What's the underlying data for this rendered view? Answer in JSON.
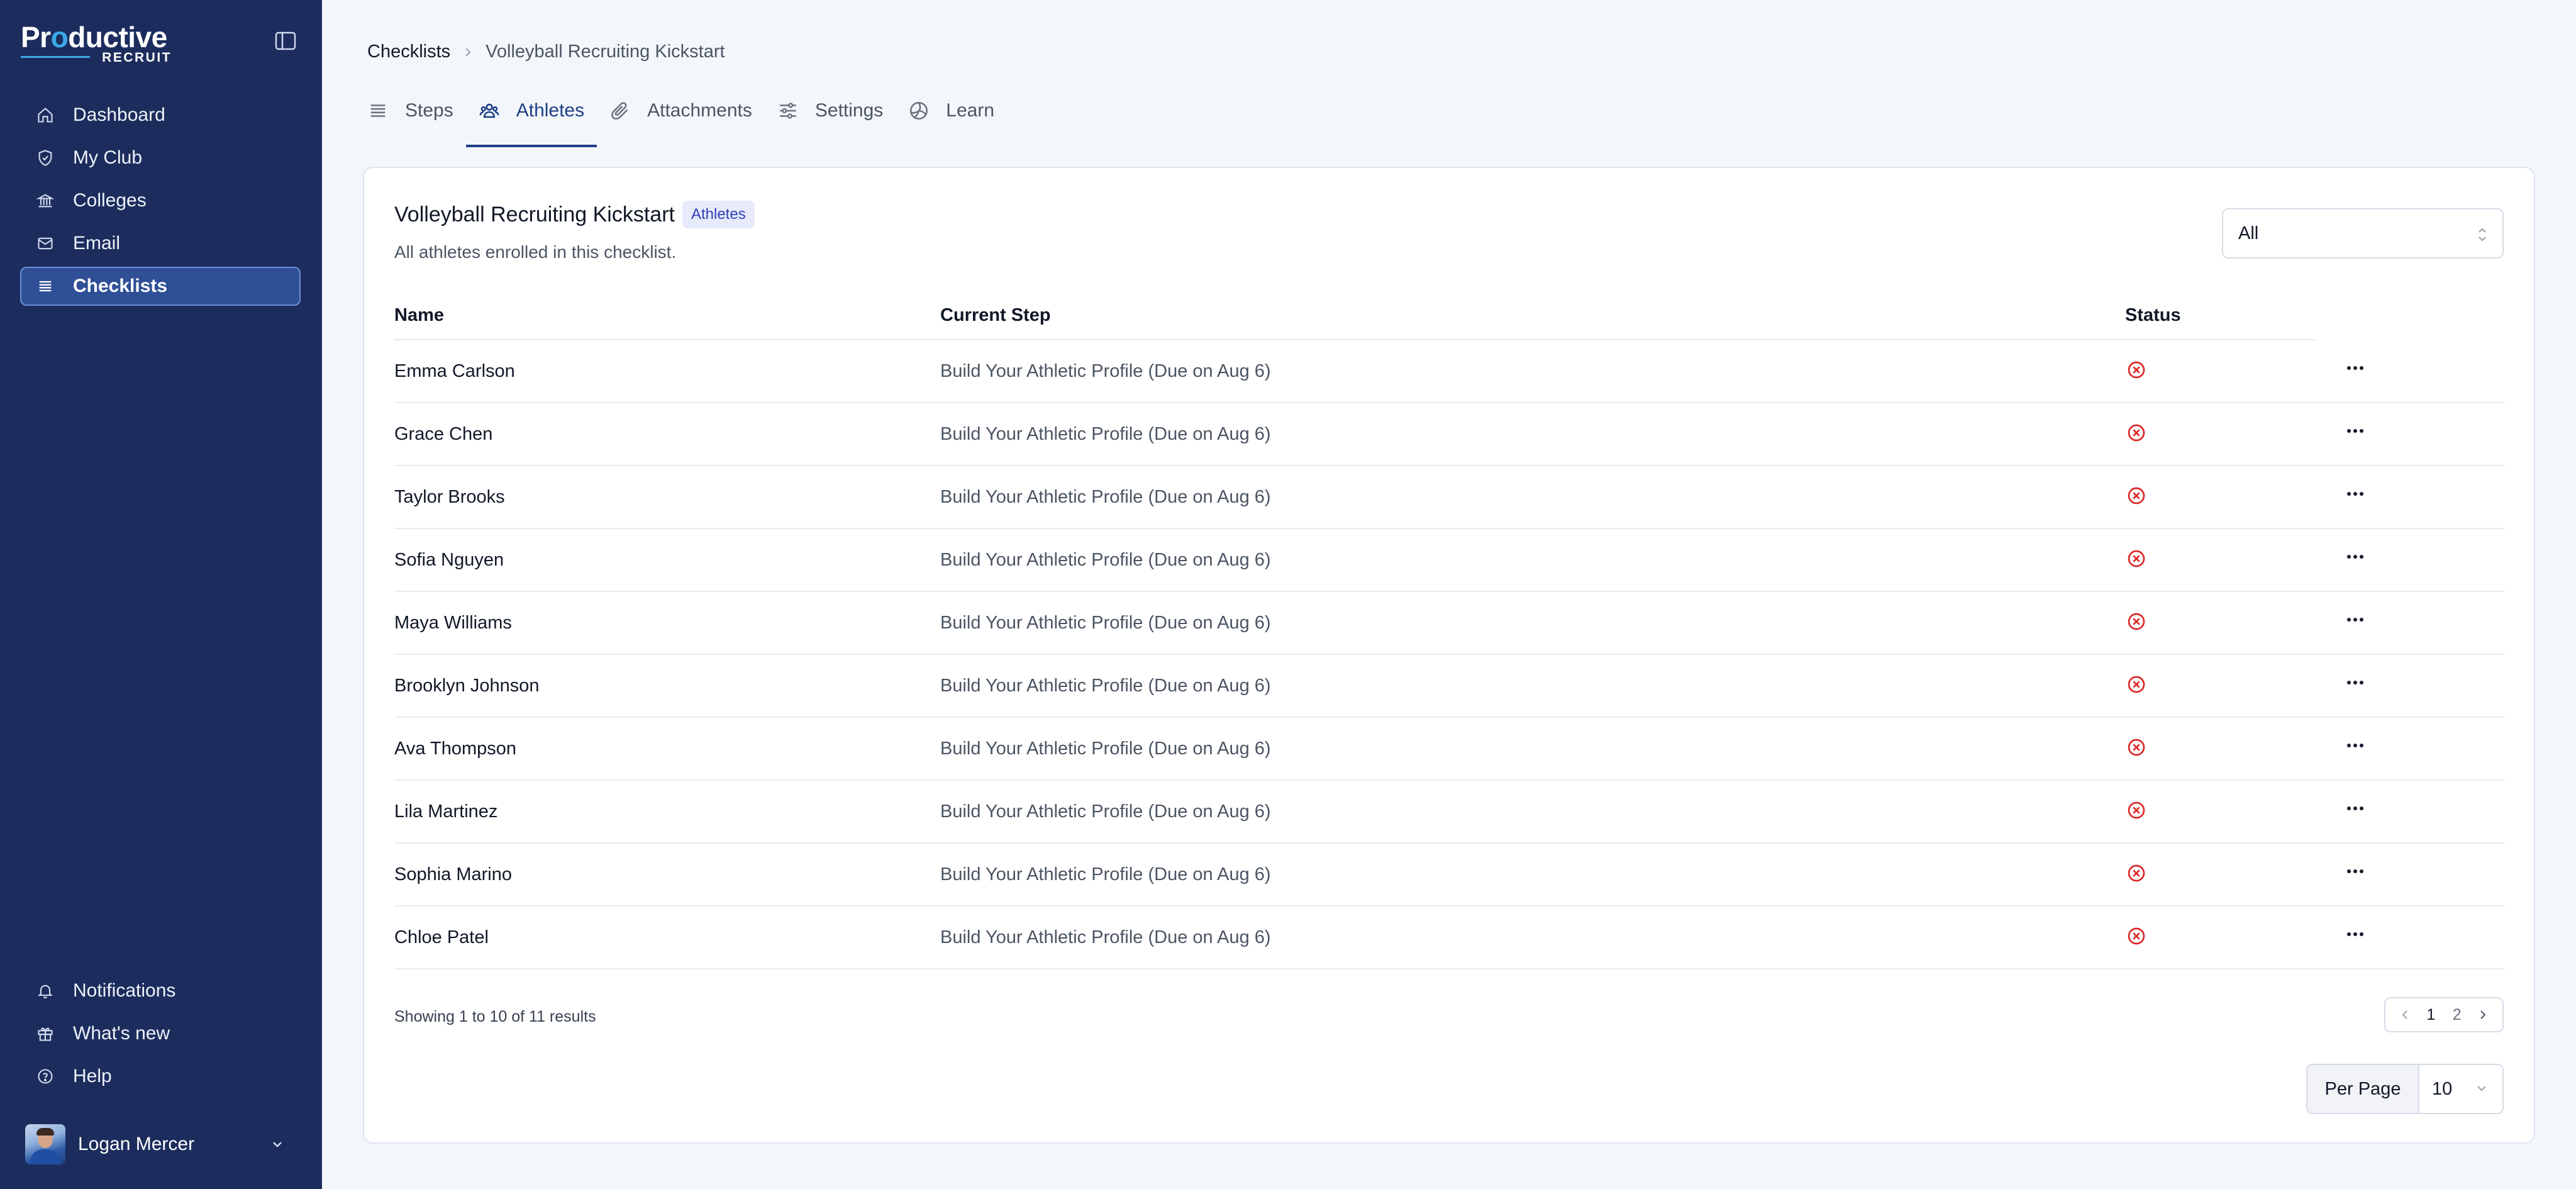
{
  "brand": {
    "name_part1": "Pr",
    "name_o": "o",
    "name_part2": "ductive",
    "subname": "RECRUIT"
  },
  "sidebar": {
    "items": [
      {
        "label": "Dashboard",
        "icon": "home-icon"
      },
      {
        "label": "My Club",
        "icon": "shield-icon"
      },
      {
        "label": "Colleges",
        "icon": "building-icon"
      },
      {
        "label": "Email",
        "icon": "mail-icon"
      },
      {
        "label": "Checklists",
        "icon": "list-icon",
        "active": true
      }
    ],
    "bottom_items": [
      {
        "label": "Notifications",
        "icon": "bell-icon"
      },
      {
        "label": "What's new",
        "icon": "gift-icon"
      },
      {
        "label": "Help",
        "icon": "help-circle-icon"
      }
    ],
    "user": {
      "name": "Logan Mercer"
    }
  },
  "breadcrumb": {
    "root": "Checklists",
    "current": "Volleyball Recruiting Kickstart"
  },
  "tabs": [
    {
      "label": "Steps",
      "icon": "list-lines-icon"
    },
    {
      "label": "Athletes",
      "icon": "users-icon",
      "active": true
    },
    {
      "label": "Attachments",
      "icon": "paperclip-icon"
    },
    {
      "label": "Settings",
      "icon": "sliders-icon"
    },
    {
      "label": "Learn",
      "icon": "volleyball-icon"
    }
  ],
  "card": {
    "title": "Volleyball Recruiting Kickstart",
    "badge": "Athletes",
    "description": "All athletes enrolled in this checklist.",
    "filter": {
      "value": "All"
    }
  },
  "table": {
    "headers": {
      "name": "Name",
      "step": "Current Step",
      "status": "Status"
    },
    "rows": [
      {
        "name": "Emma Carlson",
        "step": "Build Your Athletic Profile (Due on Aug 6)",
        "status": "incomplete"
      },
      {
        "name": "Grace Chen",
        "step": "Build Your Athletic Profile (Due on Aug 6)",
        "status": "incomplete"
      },
      {
        "name": "Taylor Brooks",
        "step": "Build Your Athletic Profile (Due on Aug 6)",
        "status": "incomplete"
      },
      {
        "name": "Sofia Nguyen",
        "step": "Build Your Athletic Profile (Due on Aug 6)",
        "status": "incomplete"
      },
      {
        "name": "Maya Williams",
        "step": "Build Your Athletic Profile (Due on Aug 6)",
        "status": "incomplete"
      },
      {
        "name": "Brooklyn Johnson",
        "step": "Build Your Athletic Profile (Due on Aug 6)",
        "status": "incomplete"
      },
      {
        "name": "Ava Thompson",
        "step": "Build Your Athletic Profile (Due on Aug 6)",
        "status": "incomplete"
      },
      {
        "name": "Lila Martinez",
        "step": "Build Your Athletic Profile (Due on Aug 6)",
        "status": "incomplete"
      },
      {
        "name": "Sophia Marino",
        "step": "Build Your Athletic Profile (Due on Aug 6)",
        "status": "incomplete"
      },
      {
        "name": "Chloe Patel",
        "step": "Build Your Athletic Profile (Due on Aug 6)",
        "status": "incomplete"
      }
    ]
  },
  "pagination": {
    "results_text": "Showing 1 to 10 of 11 results",
    "pages": [
      "1",
      "2"
    ],
    "current_page": "1",
    "per_page_label": "Per Page",
    "per_page_value": "10"
  },
  "colors": {
    "sidebar_bg": "#1c2d5d",
    "accent": "#1f3f86",
    "status_error": "#dc2626",
    "brand_accent": "#3aa9e6"
  }
}
